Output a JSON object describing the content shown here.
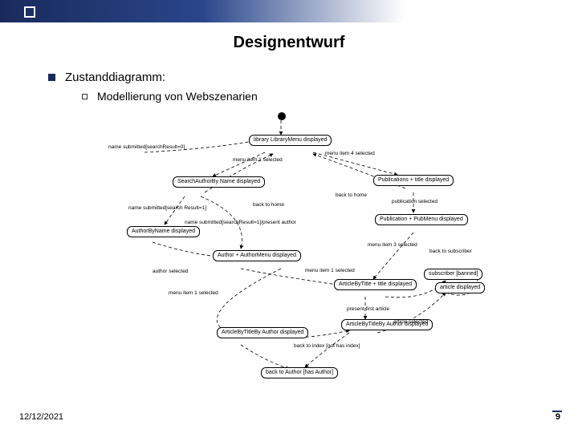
{
  "slide": {
    "title": "Designentwurf",
    "sub1": "Zustanddiagramm:",
    "sub2": "Modellierung von Webszenarien"
  },
  "footer": {
    "date": "12/12/2021",
    "page": "9"
  },
  "diagram": {
    "start": "●",
    "states": {
      "libraryMenu": "library LibraryMenu\ndisplayed",
      "searchAuthor": "SearchAuthorBy\nName displayed",
      "publications": "Publications + title\ndisplayed",
      "authorByName": "AuthorByName\ndisplayed",
      "publicationPub": "Publication + PubMenu\ndisplayed",
      "authorMenu": "Author + AuthorMenu\ndisplayed",
      "articleByTitle": "ArticleByTitle + title\ndisplayed",
      "subscriber": "subscriber [banned]",
      "articleDisplayed": "article\ndisplayed",
      "articleByTitleBy": "ArticleByTitleBy\nAuthor displayed",
      "backFinal": "back to Author [has Author]"
    },
    "transitions": {
      "nameSubmittedNull": "name submitted[searchResult=0]",
      "menuItem1Sel": "menu item 1 selected",
      "menuItem4Sel": "menu item 4 selected",
      "backToHome": "back to home",
      "backToHomeR": "back to home",
      "publicationSelected": "publication selected",
      "authorSelected": "author selected",
      "nameSubmittedPresent": "name submitted[searchResult=1]/present author",
      "nameSubmittedSearch": "name submitted[search\nResult=1]",
      "menuItem3Sel": "menu item 3 selected",
      "menuItem1Sel2": "menu item 1 selected",
      "presentFirstArticle": "present first article",
      "articleSelected": "article selected",
      "backToSearchIndex": "back to Author [has author]",
      "backToSearch": "back to subscriber",
      "backNoAuthor": "back to index [not has index]"
    }
  }
}
